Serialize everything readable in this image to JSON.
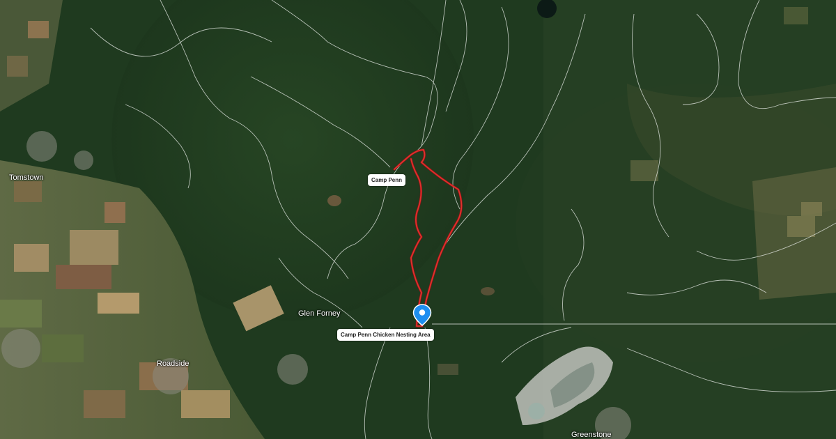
{
  "map": {
    "type": "satellite",
    "colors": {
      "forest": "#1f3a1f",
      "farmland": "#6b6a3f",
      "trail_lines": "#e8ece8",
      "route": "#d42a2a",
      "pin": "#1e8ef0"
    },
    "route_name": "",
    "marker_icon": "location-pin-icon"
  },
  "callouts": {
    "camp_penn": "Camp Penn",
    "nesting_area": "Camp Penn Chicken Nesting Area"
  },
  "places": {
    "tomstown": "Tomstown",
    "glen_forney": "Glen Forney",
    "roadside": "Roadside",
    "greenstone": "Greenstone"
  }
}
